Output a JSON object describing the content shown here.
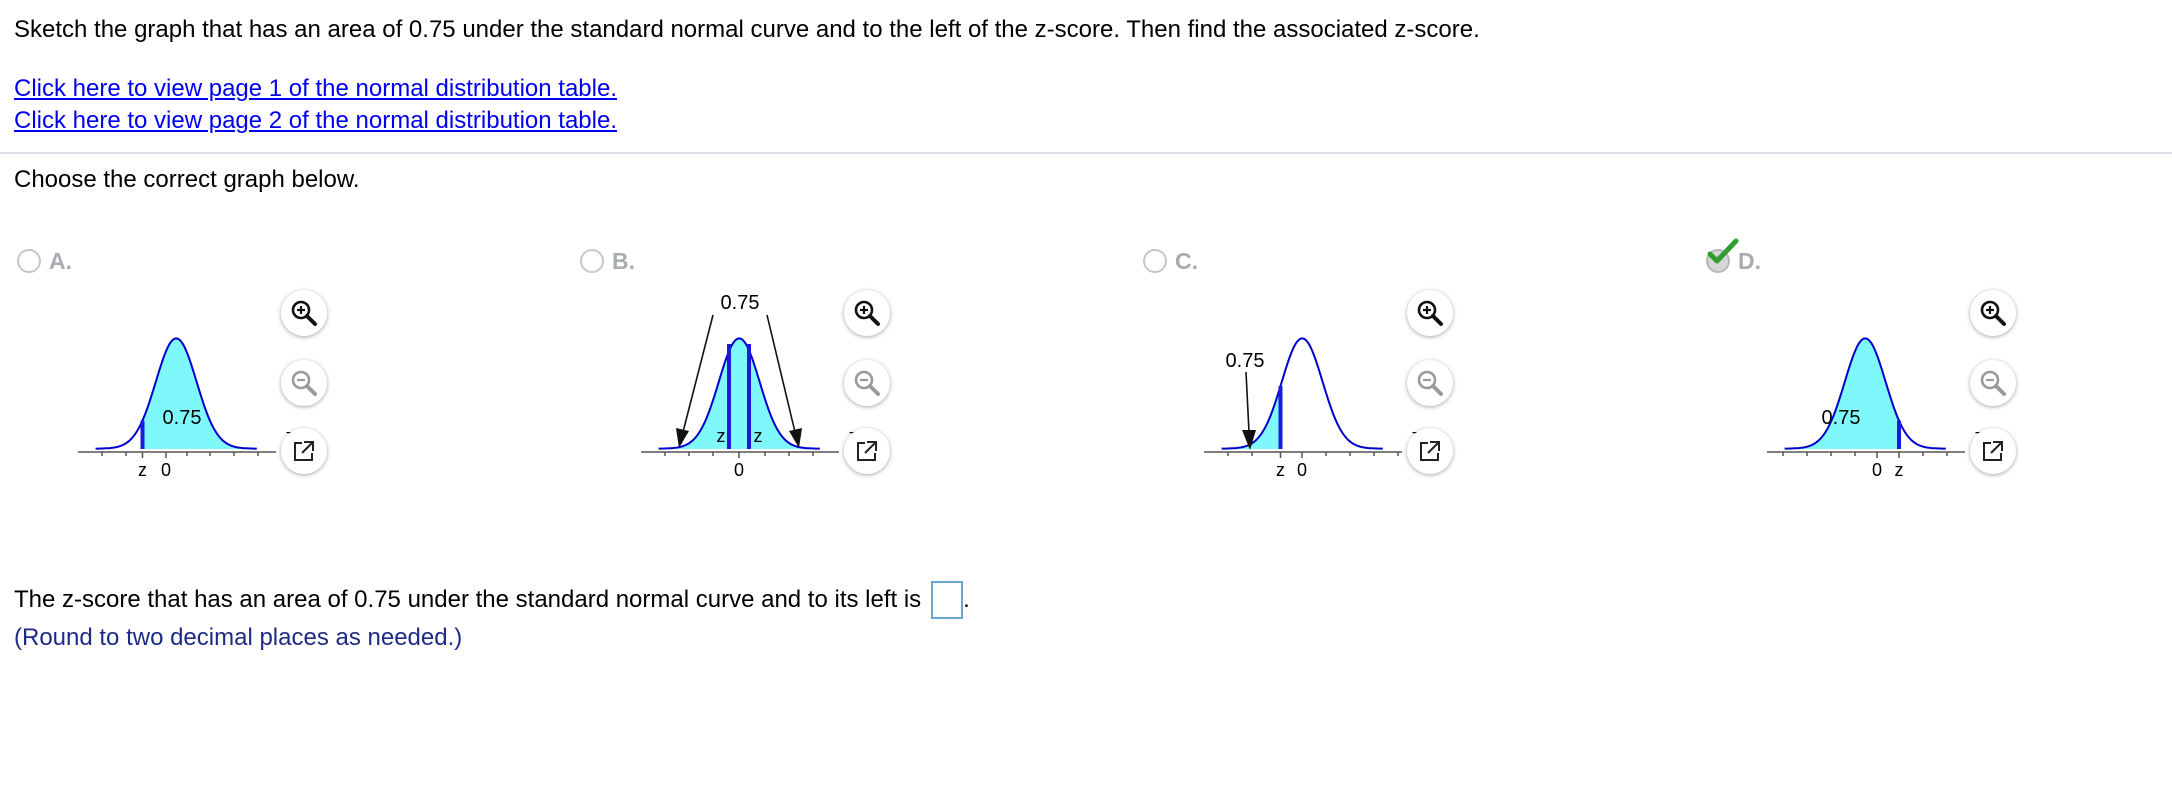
{
  "question": "Sketch the graph that has an area of 0.75 under the standard normal curve and to the left of the z-score. Then find the associated z-score.",
  "links": [
    "Click here to view page 1 of the normal distribution table.",
    "Click here to view page 2 of the normal distribution table."
  ],
  "instruction": "Choose the correct graph below.",
  "options": [
    {
      "letter": "A.",
      "selected": false,
      "area_label": "0.75",
      "axis_label": "z",
      "tick_labels": [
        "z",
        "0"
      ]
    },
    {
      "letter": "B.",
      "selected": false,
      "area_label": "0.75",
      "axis_label": "z",
      "tick_labels": [
        "0"
      ],
      "marker_labels": [
        "z",
        "z"
      ]
    },
    {
      "letter": "C.",
      "selected": false,
      "area_label": "0.75",
      "axis_label": "z",
      "tick_labels": [
        "z",
        "0"
      ]
    },
    {
      "letter": "D.",
      "selected": true,
      "area_label": "0.75",
      "axis_label": "z",
      "tick_labels": [
        "0",
        "z"
      ]
    }
  ],
  "tools": [
    "zoom-in-icon",
    "zoom-out-icon",
    "popout-icon"
  ],
  "answer": {
    "prompt": "The z-score that has an area of 0.75 under the standard normal curve and to its left is",
    "value": "",
    "suffix": "."
  },
  "hint": "(Round to two decimal places as needed.)",
  "colors": {
    "fill": "#7ff8fc",
    "curve": "#0000cc",
    "marker": "#1a1ae0",
    "link": "#0000ee",
    "hint": "#1d2a87",
    "check": "#2e9e2e"
  }
}
